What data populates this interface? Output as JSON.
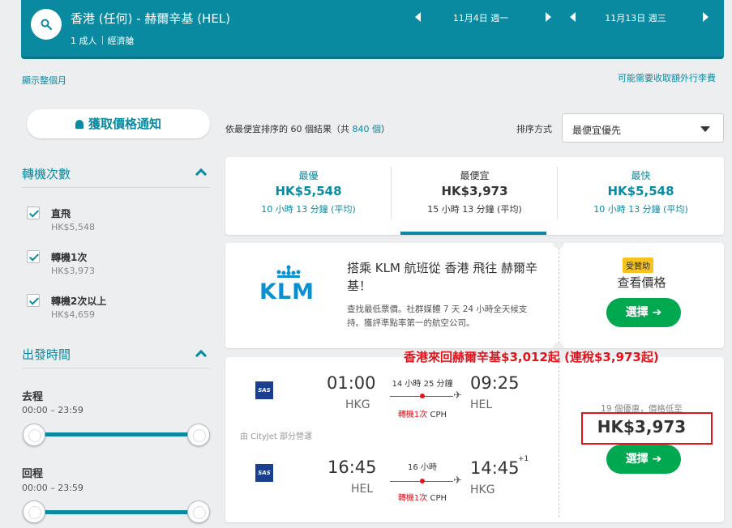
{
  "header": {
    "route": "香港 (任何) - 赫爾辛基 (HEL)",
    "passengers": "1 成人",
    "cabin": "經濟艙",
    "depart_date": "11月4日 週一",
    "return_date": "11月13日 週三"
  },
  "links": {
    "show_month": "顯示整個月",
    "extra_fees": "可能需要收取額外行李費"
  },
  "filters": {
    "price_alert": "獲取價格通知",
    "stops_title": "轉機次數",
    "stops": [
      {
        "label": "直飛",
        "price": "HK$5,548"
      },
      {
        "label": "轉機1次",
        "price": "HK$3,973"
      },
      {
        "label": "轉機2次以上",
        "price": "HK$4,659"
      }
    ],
    "departure_title": "出發時間",
    "outbound_label": "去程",
    "outbound_range": "00:00 – 23:59",
    "return_label": "回程",
    "return_range": "00:00 – 23:59"
  },
  "results": {
    "prefix": "依",
    "sort_word": "最便宜",
    "mid": "排序的 60 個結果（共 ",
    "total": "840 個",
    "suffix": "）",
    "sort_label": "排序方式",
    "sort_value": "最便宜優先"
  },
  "tabs": [
    {
      "title": "最優",
      "price": "HK$5,548",
      "duration": "10 小時 13 分鐘 (平均)"
    },
    {
      "title": "最便宜",
      "price": "HK$3,973",
      "duration": "15 小時 13 分鐘 (平均)"
    },
    {
      "title": "最快",
      "price": "HK$5,548",
      "duration": "10 小時 13 分鐘 (平均)"
    }
  ],
  "ad": {
    "logo_text": "KLM",
    "title": "搭乘 KLM 航班從 香港 飛往 赫爾辛基！",
    "description": "查找最低票價。社群媒體 7 天 24 小時全天候支持。獲評準點率第一的航空公司。",
    "sponsored": "受贊助",
    "view_price": "查看價格",
    "select": "選擇 ➔"
  },
  "promo": "香港來回赫爾辛基$3,012起 (連稅$3,973起)",
  "flight": {
    "airline_logo": "SAS",
    "operated_by": "由 CityJet 部分營運",
    "outbound": {
      "depart_time": "01:00",
      "depart_code": "HKG",
      "duration": "14 小時 25 分鐘",
      "arrive_time": "09:25",
      "arrive_code": "HEL",
      "stop_label": "轉機1次",
      "stop_airport": "CPH"
    },
    "return": {
      "depart_time": "16:45",
      "depart_code": "HEL",
      "duration": "16 小時",
      "arrive_time": "14:45",
      "arrive_code": "HKG",
      "day_offset": "+1",
      "stop_label": "轉機1次",
      "stop_airport": "CPH"
    },
    "deals_text": "19 個優惠，價格低至",
    "price": "HK$3,973",
    "select": "選擇 ➔"
  },
  "colors": {
    "brand": "#0a8aa0",
    "select_green": "#00a850",
    "highlight_red": "#e3141c",
    "sponsor_yellow": "#f6c21c"
  }
}
